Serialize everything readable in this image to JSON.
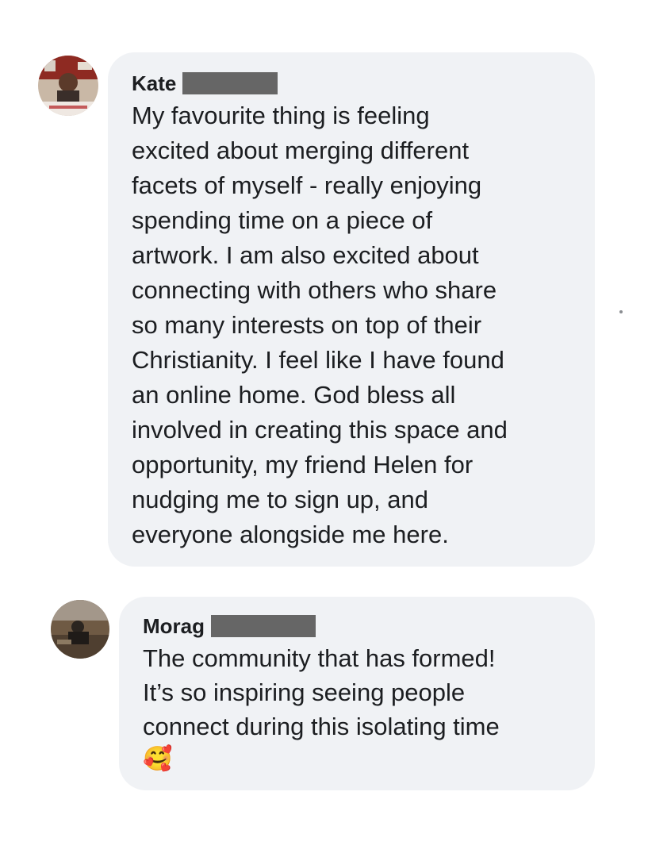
{
  "comments": [
    {
      "author": "Kate",
      "lines": [
        "My favourite thing is feeling",
        "excited about merging different",
        "facets of myself - really enjoying",
        "spending time on a piece of",
        "artwork. I am also excited about",
        "connecting with others who share",
        "so many interests on top of their",
        "Christianity. I feel like I have found",
        "an online home. God bless all",
        "involved in creating this space and",
        "opportunity, my friend Helen for",
        "nudging me to sign up, and",
        "everyone alongside me here."
      ]
    },
    {
      "author": "Morag",
      "lines": [
        "The community that has formed!",
        "It’s so inspiring seeing people",
        "connect during this isolating time"
      ],
      "emoji": "🥰"
    }
  ],
  "colors": {
    "bubble": "#f0f2f5",
    "redaction": "#666666",
    "text": "#1c1e21"
  }
}
